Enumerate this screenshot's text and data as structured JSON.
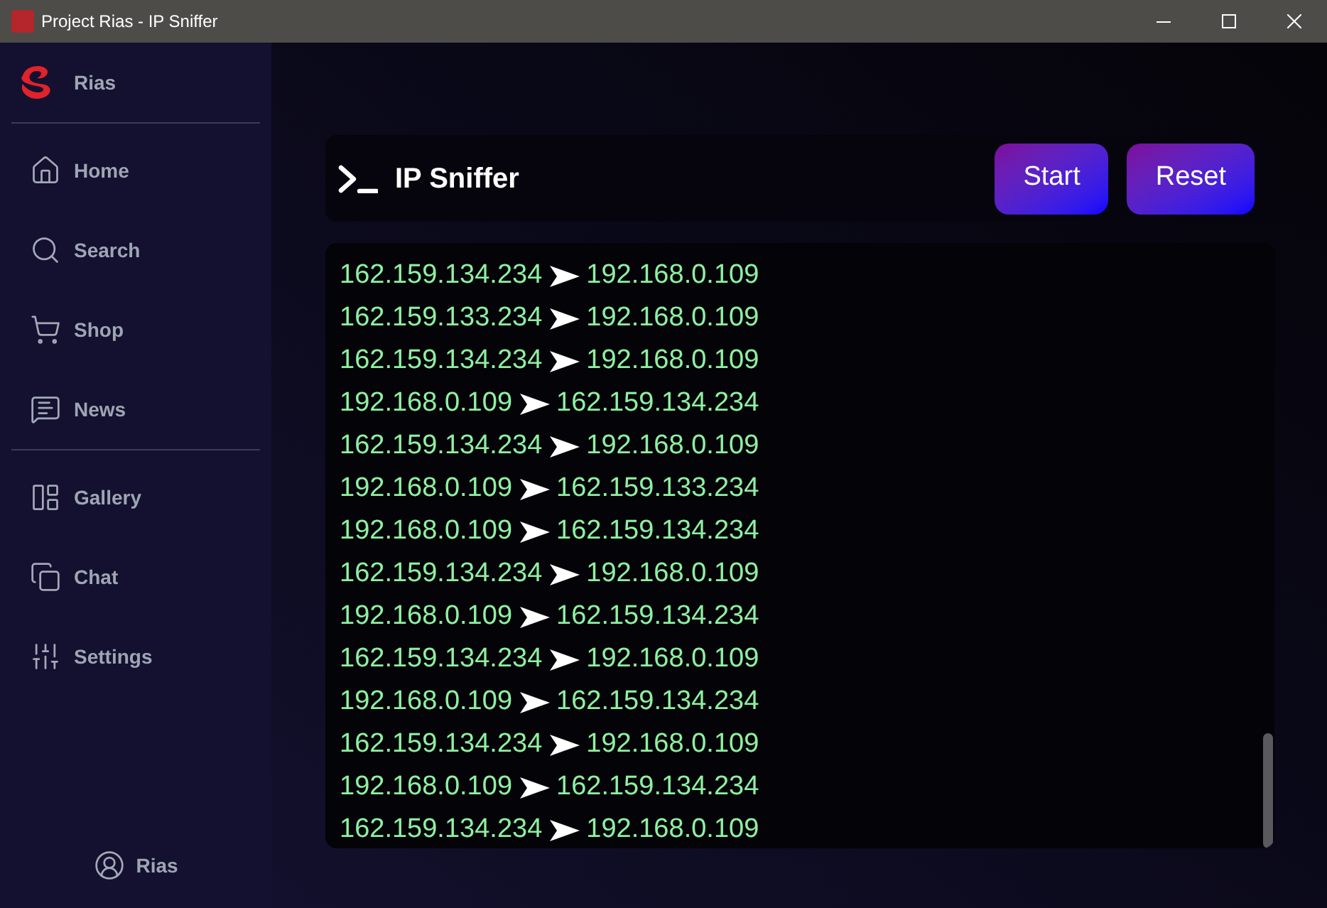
{
  "window": {
    "title": "Project Rias - IP Sniffer"
  },
  "sidebar": {
    "brand": "Rias",
    "sections": [
      {
        "items": [
          {
            "label": "Home"
          },
          {
            "label": "Search"
          },
          {
            "label": "Shop"
          },
          {
            "label": "News"
          }
        ]
      },
      {
        "items": [
          {
            "label": "Gallery"
          },
          {
            "label": "Chat"
          },
          {
            "label": "Settings"
          }
        ]
      }
    ],
    "user": {
      "name": "Rias"
    }
  },
  "header": {
    "title": "IP Sniffer",
    "buttons": [
      "Start",
      "Reset"
    ]
  },
  "log": {
    "lines": [
      {
        "source": "162.159.134.234",
        "destination": "192.168.0.109"
      },
      {
        "source": "162.159.133.234",
        "destination": "192.168.0.109"
      },
      {
        "source": "162.159.134.234",
        "destination": "192.168.0.109"
      },
      {
        "source": "192.168.0.109",
        "destination": "162.159.134.234"
      },
      {
        "source": "162.159.134.234",
        "destination": "192.168.0.109"
      },
      {
        "source": "192.168.0.109",
        "destination": "162.159.133.234"
      },
      {
        "source": "192.168.0.109",
        "destination": "162.159.134.234"
      },
      {
        "source": "162.159.134.234",
        "destination": "192.168.0.109"
      },
      {
        "source": "192.168.0.109",
        "destination": "162.159.134.234"
      },
      {
        "source": "162.159.134.234",
        "destination": "192.168.0.109"
      },
      {
        "source": "192.168.0.109",
        "destination": "162.159.134.234"
      },
      {
        "source": "162.159.134.234",
        "destination": "192.168.0.109"
      },
      {
        "source": "192.168.0.109",
        "destination": "162.159.134.234"
      },
      {
        "source": "162.159.134.234",
        "destination": "192.168.0.109"
      }
    ]
  }
}
